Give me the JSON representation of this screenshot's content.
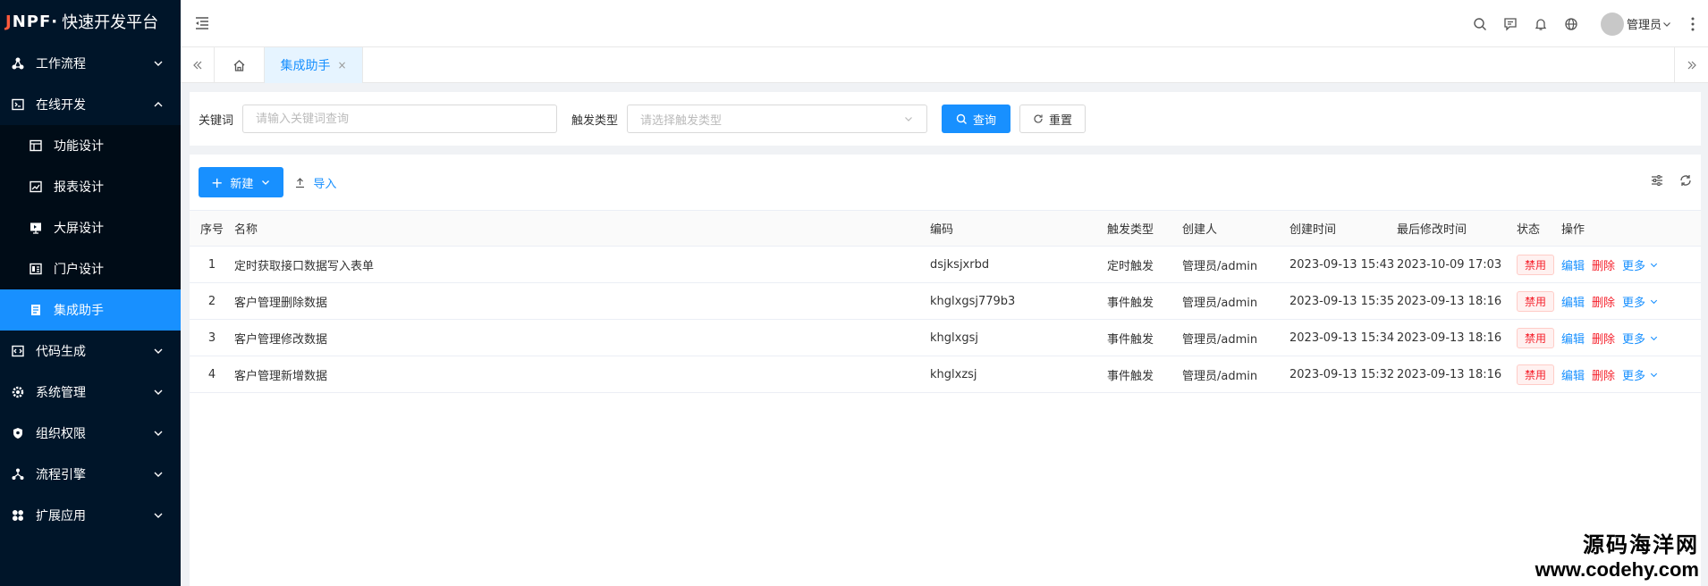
{
  "app": {
    "logo_brand_a": "J",
    "logo_brand_b": "NPF",
    "logo_sep": "·",
    "logo_text": "快速开发平台"
  },
  "sidebar": {
    "items": [
      {
        "label": "工作流程",
        "icon": "workflow-icon",
        "expanded": false
      },
      {
        "label": "在线开发",
        "icon": "code-window-icon",
        "expanded": true,
        "children": [
          {
            "label": "功能设计",
            "icon": "form-icon",
            "active": false
          },
          {
            "label": "报表设计",
            "icon": "chart-icon",
            "active": false
          },
          {
            "label": "大屏设计",
            "icon": "screen-icon",
            "active": false
          },
          {
            "label": "门户设计",
            "icon": "portal-icon",
            "active": false
          },
          {
            "label": "集成助手",
            "icon": "integration-icon",
            "active": true
          }
        ]
      },
      {
        "label": "代码生成",
        "icon": "code-icon",
        "expanded": false
      },
      {
        "label": "系统管理",
        "icon": "gear-icon",
        "expanded": false
      },
      {
        "label": "组织权限",
        "icon": "shield-icon",
        "expanded": false
      },
      {
        "label": "流程引擎",
        "icon": "engine-icon",
        "expanded": false
      },
      {
        "label": "扩展应用",
        "icon": "apps-icon",
        "expanded": false
      }
    ]
  },
  "header": {
    "user_name": "管理员"
  },
  "tabs": {
    "active_label": "集成助手",
    "close_glyph": "×"
  },
  "search": {
    "keyword_label": "关键词",
    "keyword_placeholder": "请输入关键词查询",
    "trigger_label": "触发类型",
    "trigger_placeholder": "请选择触发类型",
    "query_label": "查询",
    "reset_label": "重置"
  },
  "toolbar": {
    "new_label": "新建",
    "import_label": "导入"
  },
  "table": {
    "columns": [
      "序号",
      "名称",
      "编码",
      "触发类型",
      "创建人",
      "创建时间",
      "最后修改时间",
      "状态",
      "操作"
    ],
    "rows": [
      {
        "idx": "1",
        "name": "定时获取接口数据写入表单",
        "code": "dsjksjxrbd",
        "trigger": "定时触发",
        "creator": "管理员/admin",
        "created": "2023-09-13 15:43",
        "modified": "2023-10-09 17:03",
        "status": "禁用"
      },
      {
        "idx": "2",
        "name": "客户管理删除数据",
        "code": "khglxgsj779b3",
        "trigger": "事件触发",
        "creator": "管理员/admin",
        "created": "2023-09-13 15:35",
        "modified": "2023-09-13 18:16",
        "status": "禁用"
      },
      {
        "idx": "3",
        "name": "客户管理修改数据",
        "code": "khglxgsj",
        "trigger": "事件触发",
        "creator": "管理员/admin",
        "created": "2023-09-13 15:34",
        "modified": "2023-09-13 18:16",
        "status": "禁用"
      },
      {
        "idx": "4",
        "name": "客户管理新增数据",
        "code": "khglxzsj",
        "trigger": "事件触发",
        "creator": "管理员/admin",
        "created": "2023-09-13 15:32",
        "modified": "2023-09-13 18:16",
        "status": "禁用"
      }
    ],
    "actions": {
      "edit": "编辑",
      "delete": "删除",
      "more": "更多"
    }
  },
  "watermark": {
    "line1": "源码海洋网",
    "line2": "www.codehy.com"
  },
  "colors": {
    "sidebar_bg": "#001529",
    "primary": "#1890ff",
    "danger": "#f5222d"
  }
}
